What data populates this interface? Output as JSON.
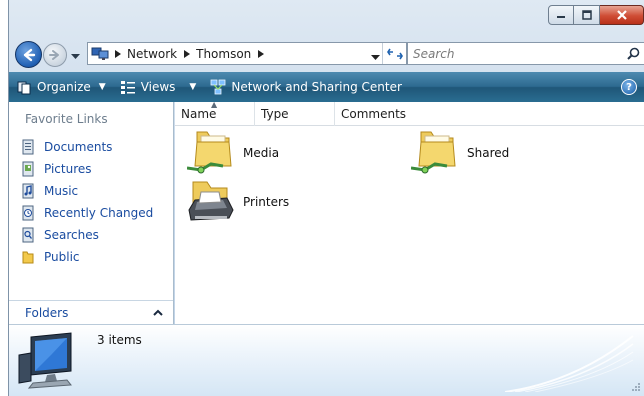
{
  "window": {
    "caption_buttons": [
      {
        "name": "minimize",
        "icon": "minimize-icon"
      },
      {
        "name": "maximize",
        "icon": "maximize-icon"
      },
      {
        "name": "close",
        "icon": "close-icon"
      }
    ]
  },
  "address_bar": {
    "crumbs": [
      "Network",
      "Thomson"
    ],
    "icons": {
      "back": "back-arrow-icon",
      "forward": "forward-arrow-icon",
      "refresh": "refresh-icon",
      "computer": "network-computer-icon"
    }
  },
  "search": {
    "placeholder": "Search",
    "icon": "magnifier-icon"
  },
  "toolbar": {
    "organize_label": "Organize",
    "views_label": "Views",
    "network_center_label": "Network and Sharing Center",
    "help_label": "?"
  },
  "nav_pane": {
    "title": "Favorite Links",
    "links": [
      {
        "label": "Documents",
        "icon": "documents-icon"
      },
      {
        "label": "Pictures",
        "icon": "pictures-icon"
      },
      {
        "label": "Music",
        "icon": "music-icon"
      },
      {
        "label": "Recently Changed",
        "icon": "recently-changed-icon"
      },
      {
        "label": "Searches",
        "icon": "searches-icon"
      },
      {
        "label": "Public",
        "icon": "public-folder-icon"
      }
    ],
    "folders_label": "Folders"
  },
  "columns": {
    "name": "Name",
    "type": "Type",
    "comments": "Comments"
  },
  "items": [
    {
      "label": "Media",
      "icon": "shared-folder-icon"
    },
    {
      "label": "Shared",
      "icon": "shared-folder-icon"
    },
    {
      "label": "Printers",
      "icon": "printer-icon"
    }
  ],
  "details": {
    "count_label": "3 items",
    "icon": "network-computer-icon"
  },
  "colors": {
    "toolbar": "#2d6a90",
    "link": "#1a4ca0",
    "close_button": "#cf4d35"
  }
}
